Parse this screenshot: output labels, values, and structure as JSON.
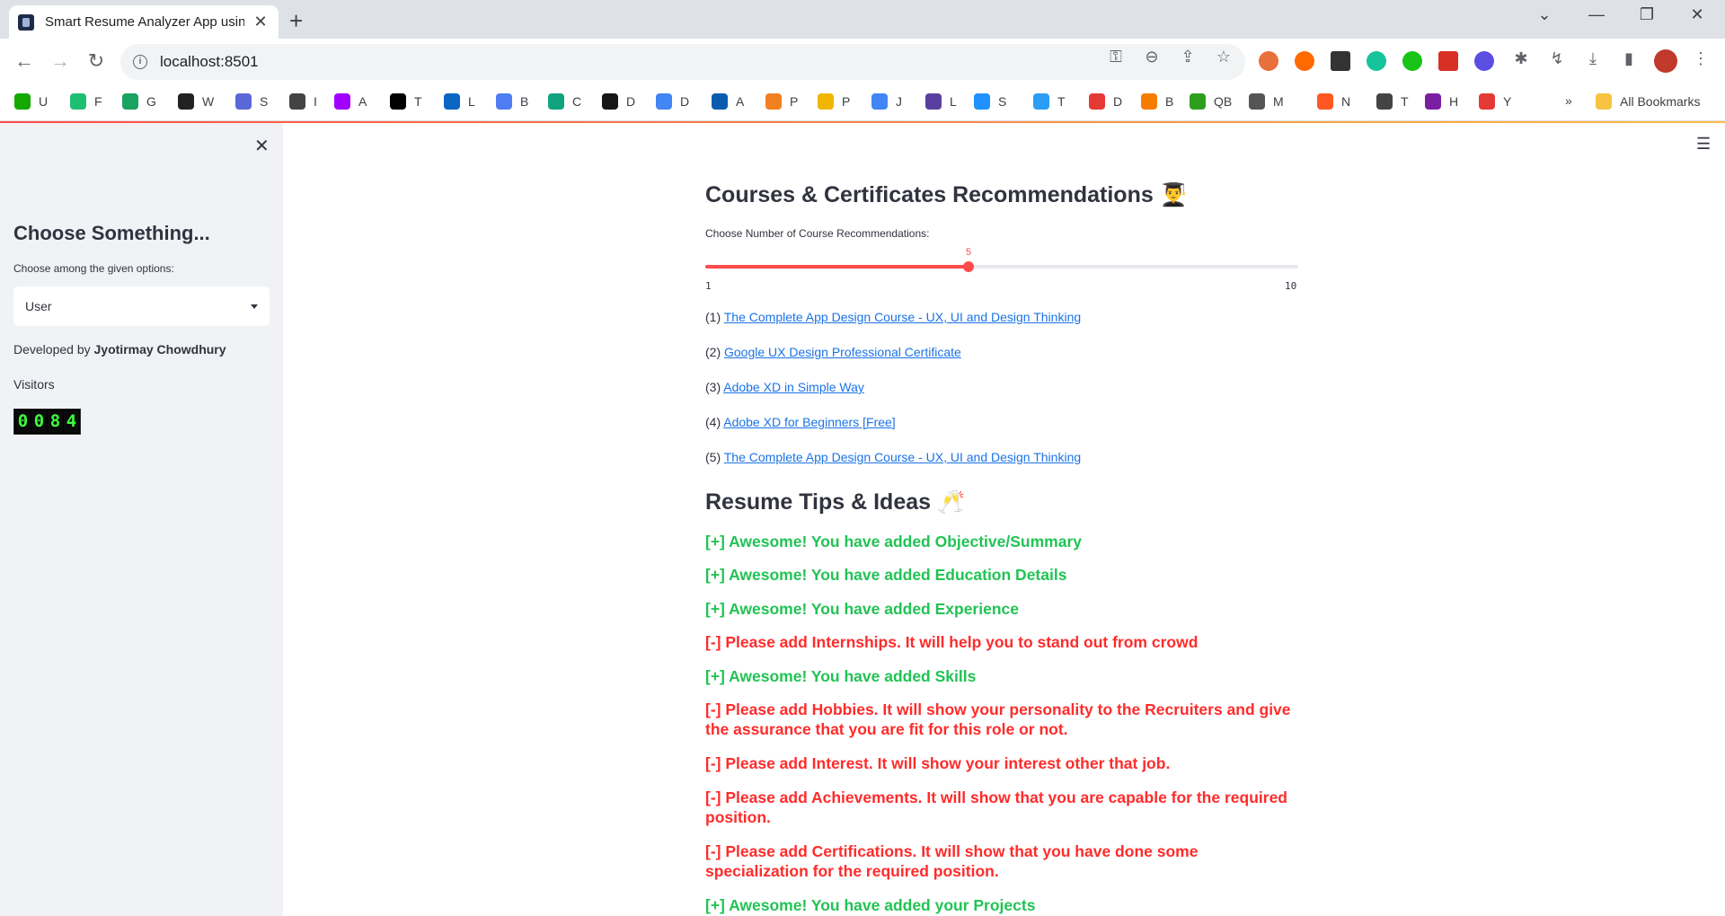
{
  "browser": {
    "tab_title": "Smart Resume Analyzer App using",
    "url": "localhost:8501",
    "bookmarks": [
      {
        "label": "U",
        "color": "#14a800"
      },
      {
        "label": "F",
        "color": "#1dbf73"
      },
      {
        "label": "G",
        "color": "#1aa260"
      },
      {
        "label": "W",
        "color": "#222222"
      },
      {
        "label": "S",
        "color": "#5a67d8"
      },
      {
        "label": "I",
        "color": "#444444"
      },
      {
        "label": "A",
        "color": "#a100ff"
      },
      {
        "label": "T",
        "color": "#000000"
      },
      {
        "label": "L",
        "color": "#0a66c2"
      },
      {
        "label": "B",
        "color": "#4f7df3"
      },
      {
        "label": "C",
        "color": "#10a37f"
      },
      {
        "label": "D",
        "color": "#181717"
      },
      {
        "label": "D",
        "color": "#4285f4"
      },
      {
        "label": "A",
        "color": "#0b5cad"
      },
      {
        "label": "P",
        "color": "#f38020"
      },
      {
        "label": "P",
        "color": "#f2b600"
      },
      {
        "label": "J",
        "color": "#4285f4"
      },
      {
        "label": "L",
        "color": "#5b3fa0"
      },
      {
        "label": "S",
        "color": "#1e90ff"
      },
      {
        "label": "T",
        "color": "#2a9df4"
      },
      {
        "label": "D",
        "color": "#e53935"
      },
      {
        "label": "B",
        "color": "#f57c00"
      },
      {
        "label": "QB",
        "color": "#2ca01c"
      },
      {
        "label": "M",
        "color": "#555555"
      },
      {
        "label": "N",
        "color": "#ff5722"
      },
      {
        "label": "T",
        "color": "#444444"
      },
      {
        "label": "H",
        "color": "#7b1fa2"
      },
      {
        "label": "Y",
        "color": "#e53935"
      }
    ],
    "overflow": "»",
    "all_bookmarks": "All Bookmarks"
  },
  "sidebar": {
    "close": "✕",
    "heading": "Choose Something...",
    "select_label": "Choose among the given options:",
    "select_value": "User",
    "developed_by_prefix": "Developed by ",
    "developer_name": "Jyotirmay Chowdhury",
    "visitors_label": "Visitors",
    "visitor_digits": [
      "0",
      "0",
      "8",
      "4"
    ]
  },
  "main": {
    "courses_heading": "Courses & Certificates Recommendations 👨‍🎓",
    "slider": {
      "label": "Choose Number of Course Recommendations:",
      "value": 5,
      "min": 1,
      "max": 10
    },
    "courses": [
      {
        "num": "(1) ",
        "title": "The Complete App Design Course - UX, UI and Design Thinking"
      },
      {
        "num": "(2) ",
        "title": "Google UX Design Professional Certificate"
      },
      {
        "num": "(3) ",
        "title": "Adobe XD in Simple Way"
      },
      {
        "num": "(4) ",
        "title": "Adobe XD for Beginners [Free]"
      },
      {
        "num": "(5) ",
        "title": "The Complete App Design Course - UX, UI and Design Thinking"
      }
    ],
    "tips_heading": "Resume Tips & Ideas 🥂",
    "tips": [
      {
        "status": "good",
        "text": "[+] Awesome! You have added Objective/Summary"
      },
      {
        "status": "good",
        "text": "[+] Awesome! You have added Education Details"
      },
      {
        "status": "good",
        "text": "[+] Awesome! You have added Experience"
      },
      {
        "status": "bad",
        "text": "[-] Please add Internships. It will help you to stand out from crowd"
      },
      {
        "status": "good",
        "text": "[+] Awesome! You have added Skills"
      },
      {
        "status": "bad",
        "text": "[-] Please add Hobbies. It will show your personality to the Recruiters and give the assurance that you are fit for this role or not."
      },
      {
        "status": "bad",
        "text": "[-] Please add Interest. It will show your interest other that job."
      },
      {
        "status": "bad",
        "text": "[-] Please add Achievements. It will show that you are capable for the required position."
      },
      {
        "status": "bad",
        "text": "[-] Please add Certifications. It will show that you have done some specialization for the required position."
      },
      {
        "status": "good",
        "text": "[+] Awesome! You have added your Projects"
      }
    ]
  },
  "colors": {
    "accent": "#ff4b4b",
    "good": "#21c354",
    "bad": "#ff2b2b",
    "link": "#1a73e8"
  }
}
